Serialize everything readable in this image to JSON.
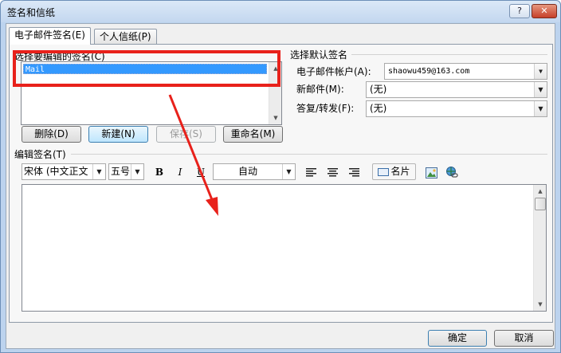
{
  "window": {
    "title": "签名和信纸",
    "help_glyph": "?",
    "close_glyph": "✕"
  },
  "tabs": [
    {
      "label": "电子邮件签名(E)",
      "active": true
    },
    {
      "label": "个人信纸(P)",
      "active": false
    }
  ],
  "signature_select": {
    "label": "选择要编辑的签名(C)",
    "items": [
      "Mail"
    ],
    "selected": "Mail"
  },
  "sig_buttons": {
    "delete": "删除(D)",
    "new": "新建(N)",
    "save": "保存(S)",
    "rename": "重命名(M)"
  },
  "defaults": {
    "label": "选择默认签名",
    "account_label": "电子邮件帐户(A):",
    "account_value": "shaowu459@163.com",
    "new_msg_label": "新邮件(M):",
    "new_msg_value": "(无)",
    "reply_label": "答复/转发(F):",
    "reply_value": "(无)"
  },
  "editor": {
    "label": "编辑签名(T)",
    "font_value": "宋体 (中文正文",
    "size_value": "五号",
    "bold": "B",
    "italic": "I",
    "underline": "U",
    "color_value": "自动",
    "business_card": "名片"
  },
  "footer": {
    "ok": "确定",
    "cancel": "取消"
  },
  "colors": {
    "highlight": "#e8211b",
    "selection": "#3399ff"
  }
}
